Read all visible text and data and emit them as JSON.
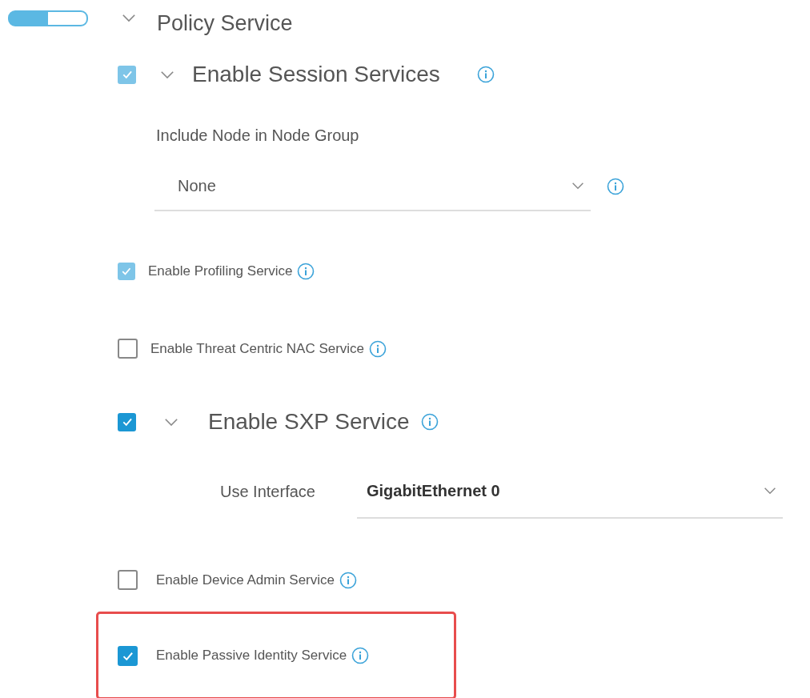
{
  "node_toggle": {
    "on": true
  },
  "section": {
    "title": "Policy Service",
    "expanded": true
  },
  "services": [
    {
      "kind": "group",
      "label": "Enable Session Services",
      "checked": true,
      "disabled": true,
      "expanded": true,
      "highlighted": false,
      "fields": [
        {
          "kind": "stacked",
          "label": "Include Node in Node Group",
          "value": "None"
        }
      ]
    },
    {
      "kind": "option",
      "label": "Enable Profiling Service",
      "checked": true,
      "disabled": true,
      "highlighted": false
    },
    {
      "kind": "option",
      "label": "Enable Threat Centric NAC Service",
      "checked": false,
      "disabled": false,
      "highlighted": false
    },
    {
      "kind": "group",
      "label": "Enable SXP Service",
      "checked": true,
      "disabled": false,
      "expanded": true,
      "highlighted": false,
      "fields": [
        {
          "kind": "inline",
          "label": "Use Interface",
          "value": "GigabitEthernet 0"
        }
      ]
    },
    {
      "kind": "option",
      "label": "Enable Device Admin Service",
      "checked": false,
      "disabled": false,
      "highlighted": false
    },
    {
      "kind": "option",
      "label": "Enable Passive Identity Service",
      "checked": true,
      "disabled": false,
      "highlighted": true
    }
  ]
}
